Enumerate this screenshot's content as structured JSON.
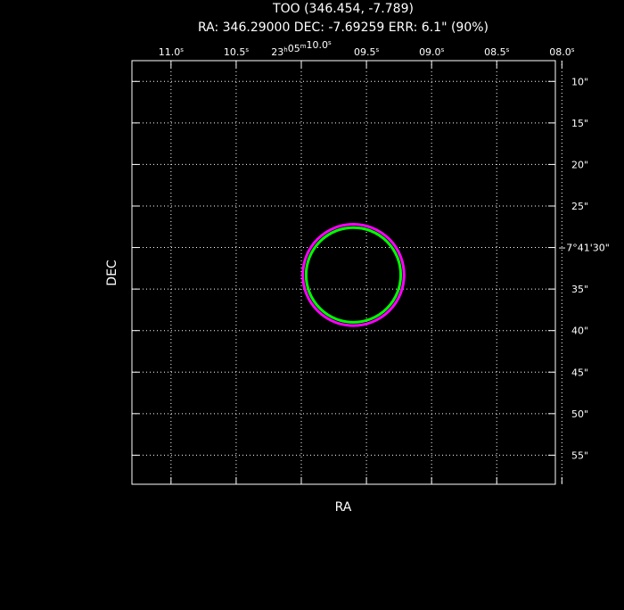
{
  "chart_data": {
    "type": "scatter",
    "title": "TOO (346.454, -7.789)",
    "subtitle": "RA: 346.29000  DEC: -7.69259  ERR: 6.1\" (90%)",
    "xlabel": "RA",
    "ylabel": "DEC",
    "grid": true,
    "x_axis": {
      "unit": "seconds of RA (23h05m)",
      "reversed": true,
      "range": [
        11.3,
        8.05
      ],
      "ticks": [
        {
          "value": 11.0,
          "label": "11.0",
          "sup": "s"
        },
        {
          "value": 10.5,
          "label": "10.5",
          "sup": "s"
        },
        {
          "value": 10.0,
          "label": "23",
          "sup": "h",
          "label2": "05",
          "sup2": "m",
          "label3": "10.0",
          "sup3": "s"
        },
        {
          "value": 9.5,
          "label": "09.5",
          "sup": "s"
        },
        {
          "value": 9.0,
          "label": "09.0",
          "sup": "s"
        },
        {
          "value": 8.5,
          "label": "08.5",
          "sup": "s"
        },
        {
          "value": 8.0,
          "label": "08.0",
          "sup": "s"
        }
      ]
    },
    "y_axis": {
      "unit": "arcseconds of DEC (-7°41')",
      "range": [
        7.5,
        58.5
      ],
      "ticks": [
        {
          "value": 10,
          "label": "10\""
        },
        {
          "value": 15,
          "label": "15\""
        },
        {
          "value": 20,
          "label": "20\""
        },
        {
          "value": 25,
          "label": "25\""
        },
        {
          "value": 30,
          "label": "−7°41'30\""
        },
        {
          "value": 35,
          "label": "35\""
        },
        {
          "value": 40,
          "label": "40\""
        },
        {
          "value": 45,
          "label": "45\""
        },
        {
          "value": 50,
          "label": "50\""
        },
        {
          "value": 55,
          "label": "55\""
        }
      ]
    },
    "series": [
      {
        "type": "circle",
        "center_ra_s": 9.6,
        "center_dec_arcsec": 33.3,
        "radius_arcsec": 6.1,
        "color": "#ff00ff"
      },
      {
        "type": "circle",
        "center_ra_s": 9.6,
        "center_dec_arcsec": 33.3,
        "radius_arcsec": 5.7,
        "color": "#00ff00"
      }
    ]
  }
}
